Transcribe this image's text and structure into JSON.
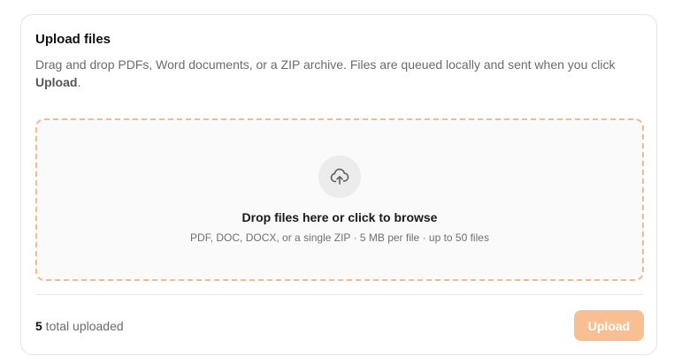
{
  "upload_card": {
    "title": "Upload files",
    "description_prefix": "Drag and drop PDFs, Word documents, or a ZIP archive. Files are queued locally and sent when you click ",
    "description_emphasis": "Upload",
    "description_suffix": ".",
    "dropzone": {
      "icon": "cloud-upload-icon",
      "title": "Drop files here or click to browse",
      "hint": "PDF, DOC, DOCX, or a single ZIP · 5 MB per file · up to 50 files"
    },
    "footer": {
      "uploaded_count": "5",
      "uploaded_label": " total uploaded",
      "upload_button_label": "Upload"
    }
  },
  "colors": {
    "accent": "#f8bf92",
    "dropzone_border": "#f5b98a",
    "dropzone_background": "#fafafa"
  }
}
